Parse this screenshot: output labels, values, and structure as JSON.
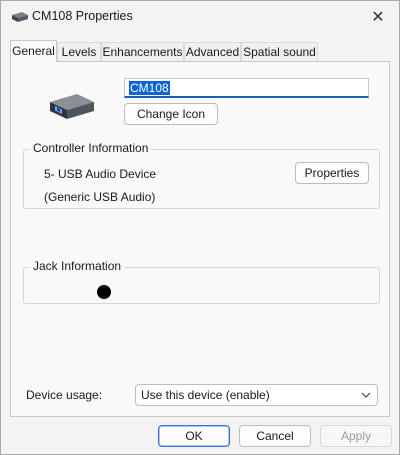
{
  "window": {
    "title": "CM108 Properties",
    "close_label": "✕"
  },
  "tabs": [
    {
      "label": "General"
    },
    {
      "label": "Levels"
    },
    {
      "label": "Enhancements"
    },
    {
      "label": "Advanced"
    },
    {
      "label": "Spatial sound"
    }
  ],
  "general": {
    "device_name": "CM108",
    "change_icon_label": "Change Icon",
    "controller": {
      "title": "Controller Information",
      "name": "5- USB Audio Device",
      "driver": "(Generic USB Audio)",
      "properties_label": "Properties"
    },
    "jack": {
      "title": "Jack Information",
      "jack_color": "#000000"
    },
    "device_usage": {
      "label": "Device usage:",
      "selected": "Use this device (enable)"
    }
  },
  "footer": {
    "ok": "OK",
    "cancel": "Cancel",
    "apply": "Apply"
  },
  "colors": {
    "accent": "#0a64d6",
    "window_bg": "#f3f3f3"
  }
}
